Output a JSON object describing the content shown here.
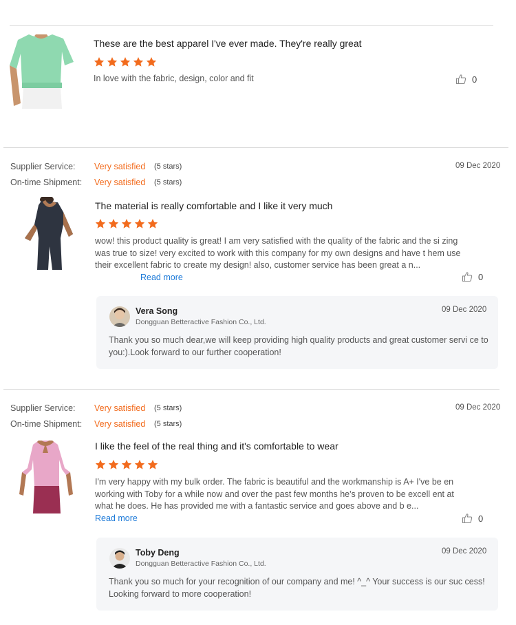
{
  "colors": {
    "accent": "#f26b1d",
    "link": "#1d7ad8",
    "star": "#f26b1d"
  },
  "reviews": [
    {
      "title": "These are the best  apparel  I've ever made. They're really great",
      "rating": 5,
      "text": "In love with the fabric, design,  color and fit",
      "likes": "0",
      "image": "mint-green-crop-top"
    },
    {
      "supplier_label": "Supplier Service:",
      "supplier_value": "Very satisfied",
      "supplier_stars": "(5 stars)",
      "shipment_label": "On-time Shipment:",
      "shipment_value": "Very satisfied",
      "shipment_stars": "(5 stars)",
      "date": "09 Dec 2020",
      "title": "The material is really comfortable and I like it very much",
      "rating": 5,
      "text": "wow! this product quality is great! I am very satisfied with the quality of the fabric and the si zing was true to size! very excited to work with this company for my own designs and have t hem use their excellent fabric to create my design! also, customer service has been great a n...",
      "read_more": "Read more",
      "likes": "0",
      "image": "dark-tank-top",
      "reply": {
        "name": "Vera Song",
        "company": "Dongguan Betteractive Fashion Co., Ltd.",
        "date": "09 Dec 2020",
        "text": "Thank you so much dear,we will keep providing high quality products and great customer servi ce to you:).Look forward to our further cooperation!"
      }
    },
    {
      "supplier_label": "Supplier Service:",
      "supplier_value": "Very satisfied",
      "supplier_stars": "(5 stars)",
      "shipment_label": "On-time Shipment:",
      "shipment_value": "Very satisfied",
      "shipment_stars": "(5 stars)",
      "date": "09 Dec 2020",
      "title": "I like the feel of the real thing and it's comfortable to wear",
      "rating": 5,
      "text": "I'm very happy with my bulk order. The fabric is beautiful and the workmanship is A+ I've be en working with Toby for a while now and over the past few months he's proven to be excell ent at what he does. He has provided me with a fantastic service and goes above and b e...",
      "read_more": "Read more",
      "likes": "0",
      "image": "pink-crop-top",
      "reply": {
        "name": "Toby Deng",
        "company": "Dongguan Betteractive Fashion Co., Ltd.",
        "date": "09 Dec 2020",
        "text": "Thank you so much for your recognition of our company and me!  ^_^ Your success is our suc cess! Looking forward to more cooperation!"
      }
    }
  ]
}
